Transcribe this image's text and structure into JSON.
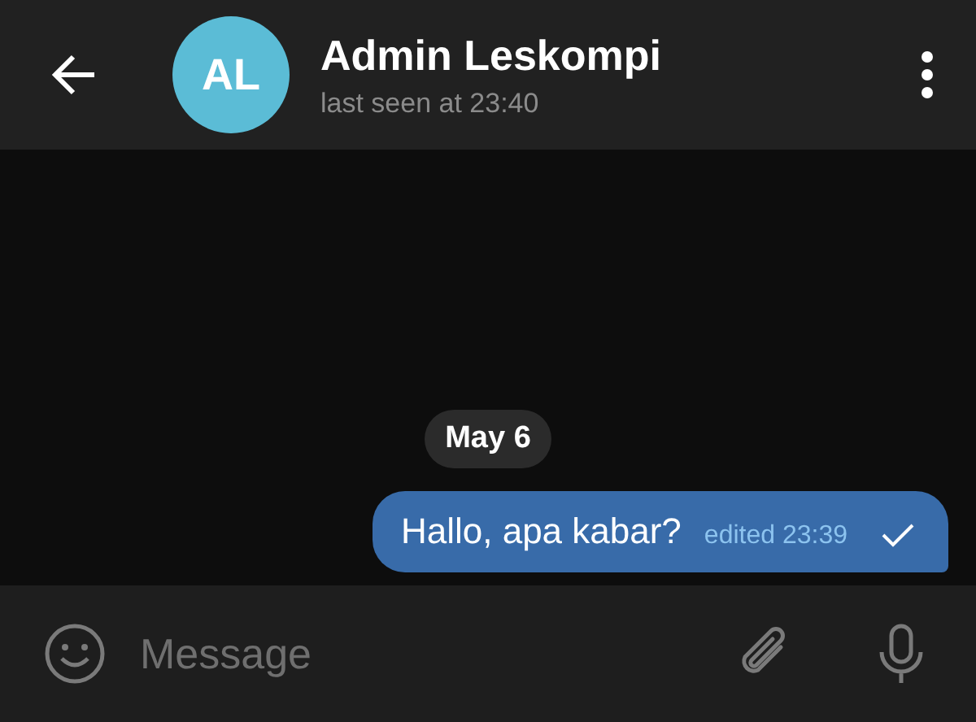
{
  "header": {
    "avatar_initials": "AL",
    "name": "Admin Leskompi",
    "status": "last seen at 23:40"
  },
  "messages": [
    {
      "kind": "date",
      "text": "May 6"
    },
    {
      "kind": "outgoing",
      "text": "Hallo, apa kabar?",
      "meta": "edited 23:39",
      "read": false
    }
  ],
  "composer": {
    "placeholder": "Message"
  }
}
